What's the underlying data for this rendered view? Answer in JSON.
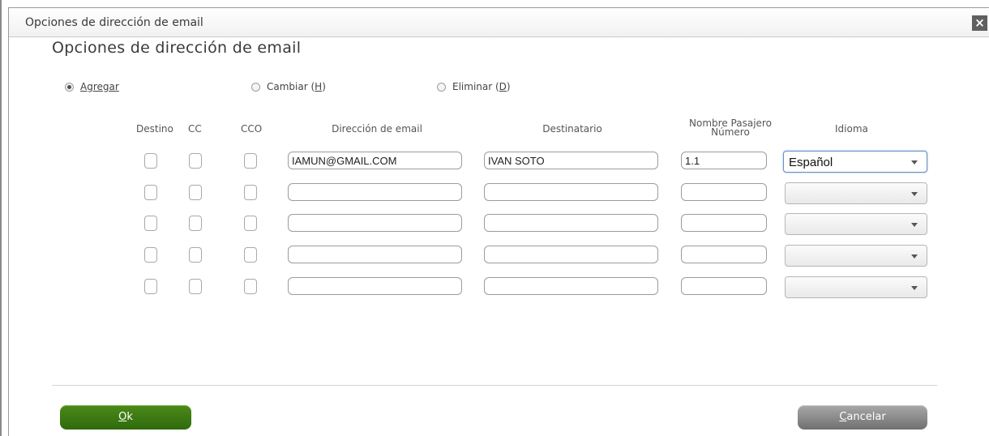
{
  "window": {
    "title": "Opciones de dirección de email",
    "close_glyph": "×"
  },
  "heading": "Opciones de dirección de email",
  "radios": [
    {
      "label": "Agregar",
      "selected": true
    },
    {
      "label_prefix": "Cambiar (",
      "mnemonic": "H",
      "label_suffix": ")",
      "selected": false
    },
    {
      "label_prefix": "Eliminar (",
      "mnemonic": "D",
      "label_suffix": ")",
      "selected": false
    }
  ],
  "columns": {
    "destino": "Destino",
    "cc": "CC",
    "cco": "CCO",
    "email": "Dirección de email",
    "destinatario": "Destinatario",
    "pasajero_line1": "Nombre Pasajero",
    "pasajero_line2": "Número",
    "idioma": "Idioma"
  },
  "rows": [
    {
      "email": "IAMUN@GMAIL.COM",
      "destinatario": "IVAN SOTO",
      "pasajero": "1.1",
      "idioma": "Español"
    },
    {
      "email": "",
      "destinatario": "",
      "pasajero": "",
      "idioma": ""
    },
    {
      "email": "",
      "destinatario": "",
      "pasajero": "",
      "idioma": ""
    },
    {
      "email": "",
      "destinatario": "",
      "pasajero": "",
      "idioma": ""
    },
    {
      "email": "",
      "destinatario": "",
      "pasajero": "",
      "idioma": ""
    }
  ],
  "buttons": {
    "ok_mnemonic": "O",
    "ok_rest": "k",
    "cancel_mnemonic": "C",
    "cancel_rest": "ancelar"
  },
  "colors": {
    "ok_button": "#3a7612",
    "cancel_button": "#8a8a8a",
    "active_select_border": "#6b8fc2"
  }
}
